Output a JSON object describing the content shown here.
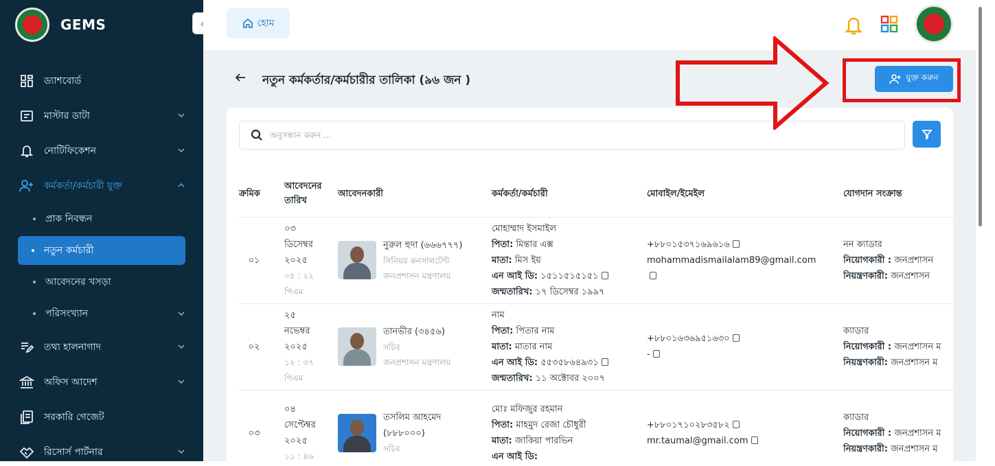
{
  "app": {
    "name": "GEMS"
  },
  "sidebar": {
    "collapse_icon": "chevrons-left-icon",
    "items": [
      {
        "label": "ড্যাশবোর্ড",
        "icon": "dashboard-icon"
      },
      {
        "label": "মাস্টার ডাটা",
        "icon": "folder-icon"
      },
      {
        "label": "নোটিফিকেশন",
        "icon": "bell-icon"
      },
      {
        "label": "কর্মকর্তা/কর্মচারী যুক্ত",
        "icon": "user-add-icon"
      },
      {
        "label": "তথ্য হালনাগাদ",
        "icon": "edit-list-icon"
      },
      {
        "label": "অফিস আদেশ",
        "icon": "bank-icon"
      },
      {
        "label": "সরকারি গেজেট",
        "icon": "document-icon"
      },
      {
        "label": "রিসোর্স পার্টনার",
        "icon": "handshake-icon"
      }
    ],
    "sub_items": [
      {
        "label": "প্রাক নিবন্ধন"
      },
      {
        "label": "নতুন কর্মচারী"
      },
      {
        "label": "আবেদনের খসড়া"
      },
      {
        "label": "পরিসংখ্যান"
      }
    ]
  },
  "topbar": {
    "home_label": "হোম"
  },
  "page": {
    "title": "নতুন কর্মকর্তার/কর্মচারীর তালিকা (৯৬ জন )",
    "add_button": "যুক্ত করুন",
    "search_placeholder": "অনুসন্ধান করুন ..."
  },
  "table": {
    "headers": {
      "serial": "ক্রমিক",
      "date_line1": "আবেদনের",
      "date_line2": "তারিখ",
      "applicant": "আবেদনকারী",
      "officer": "কর্মকর্তা/কর্মচারী",
      "contact": "মোবাইল/ইমেইল",
      "joining": "যোগদান সংক্রান্ত"
    },
    "field_labels": {
      "father": "পিতা:",
      "mother": "মাতা:",
      "nid": "এন আই ডি:",
      "dob": "জন্মতারিখ:",
      "appointer": "নিয়োগকারী :",
      "controller": "নিয়ন্ত্রণকারী:"
    },
    "rows": [
      {
        "serial": "০১",
        "date_day": "০৩",
        "date_month": "ডিসেম্বর",
        "date_year": "২০২৫",
        "time": "০৪ : ২২",
        "ampm": "পিএম",
        "applicant_name": "নুরুল হুদা (৬৬৬৭৭৭)",
        "applicant_designation": "সিনিয়র কনসালটেন্ট",
        "applicant_ministry": "জনপ্রশাসন মন্ত্রণালয়",
        "officer_name": "মোহাম্মাদ ইসমাইল",
        "father": "মিন্তার এক্স",
        "mother": "মিস ইয়",
        "nid": "১৫১১৫১৫১৫১",
        "dob": "১৭ ডিসেম্বর ১৯৯৭",
        "mobile": "+৮৮০১৫৩৭১৬৯৬১৬",
        "email": "mohammadismailalam89@gmail.com",
        "cadre": "নন ক্যাডার",
        "appointer": "জনপ্রশাসন",
        "controller": "জনপ্রশাসন"
      },
      {
        "serial": "০২",
        "date_day": "২৫",
        "date_month": "নভেম্বর",
        "date_year": "২০২৫",
        "time": "১২ : ৩৭",
        "ampm": "পিএম",
        "applicant_name": "তানভীর (৩৪৫৬)",
        "applicant_designation": "সচিব",
        "applicant_ministry": "জনপ্রশাসন মন্ত্রণালয়",
        "officer_name": "নাম",
        "father": "পিতার নাম",
        "mother": "মাতার নাম",
        "nid": "৫৫৩৫৮৬৪৯৩১",
        "dob": "১১ অক্টোবর ২০০৭",
        "mobile": "+৮৮০১৬৩৬৯৫১৬৩০",
        "email": "-",
        "cadre": "ক্যাডার",
        "appointer": "জনপ্রশাসন ম",
        "controller": "জনপ্রশাসন ম"
      },
      {
        "serial": "০৩",
        "date_day": "০৪",
        "date_month": "সেপ্টেম্বর",
        "date_year": "২০২৫",
        "time": "১১ : ৪৬",
        "ampm": "",
        "applicant_name": "তসলিম আহমেদ",
        "applicant_name2": "(৮৮৮০০০)",
        "applicant_designation": "সচিব",
        "applicant_ministry": "",
        "officer_name": "মোঃ মফিজুর রহমান",
        "father": "মাহমুদ রেজা চৌধুরী",
        "mother": "জাকিয়া পারভিন",
        "nid": "",
        "dob": "",
        "mobile": "+৮৮০১৭১০২৮৩৫৮২",
        "email": "mr.taumal@gmail.com",
        "cadre": "ক্যাডার",
        "appointer": "জনপ্রশাসন ম",
        "controller": "জনপ্রশাসন ম"
      }
    ]
  },
  "colors": {
    "sidebar_bg": "#0c2a3c",
    "accent": "#2a8ee6",
    "annotation": "#e11414"
  }
}
